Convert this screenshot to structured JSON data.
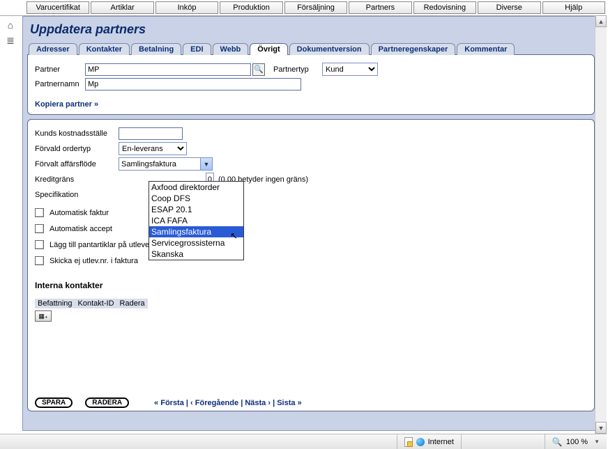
{
  "topmenu": [
    "Varucertifikat",
    "Artiklar",
    "Inköp",
    "Produktion",
    "Försäljning",
    "Partners",
    "Redovisning",
    "Diverse",
    "Hjälp"
  ],
  "page_title": "Uppdatera partners",
  "tabs": [
    "Adresser",
    "Kontakter",
    "Betalning",
    "EDI",
    "Webb",
    "Övrigt",
    "Dokumentversion",
    "Partneregenskaper",
    "Kommentar"
  ],
  "active_tab": "Övrigt",
  "form1": {
    "partner_label": "Partner",
    "partner_value": "MP",
    "partnertyp_label": "Partnertyp",
    "partnertyp_value": "Kund",
    "partnernamn_label": "Partnernamn",
    "partnernamn_value": "Mp",
    "kopiera_link": "Kopiera partner »"
  },
  "form2": {
    "kostnadsstalle_label": "Kunds kostnadsställe",
    "kostnadsstalle_value": "",
    "ordertyp_label": "Förvald ordertyp",
    "ordertyp_value": "En-leverans",
    "affarsflode_label": "Förvalt affärsflöde",
    "affarsflode_value": "Samlingsfaktura",
    "affarsflode_options": [
      "Axfood direktorder",
      "Coop DFS",
      "ESAP 20.1",
      "ICA FAFA",
      "Samlingsfaktura",
      "Servicegrossisterna",
      "Skanska"
    ],
    "affarsflode_selected": "Samlingsfaktura",
    "kreditgrans_label": "Kreditgräns",
    "kreditgrans_edge": "0",
    "kreditgrans_hint": "(0.00 betyder ingen gräns)",
    "specifikation_label": "Specifikation",
    "chk1": "Automatisk faktur",
    "chk2": "Automatisk accept",
    "chk3": "Lägg till pantartiklar på utleverans",
    "chk4": "Skicka ej utlev.nr. i faktura",
    "interna_heading": "Interna kontakter",
    "tbl_headers": [
      "Befattning",
      "Kontakt-ID",
      "Radera"
    ]
  },
  "bottom": {
    "spara": "SPARA",
    "radera": "RADERA",
    "nav_first": "« Första",
    "nav_prev": "‹ Föregående",
    "nav_next": "Nästa ›",
    "nav_last": "Sista »",
    "sep": " | "
  },
  "status": {
    "zone": "Internet",
    "zoom": "100 %"
  }
}
